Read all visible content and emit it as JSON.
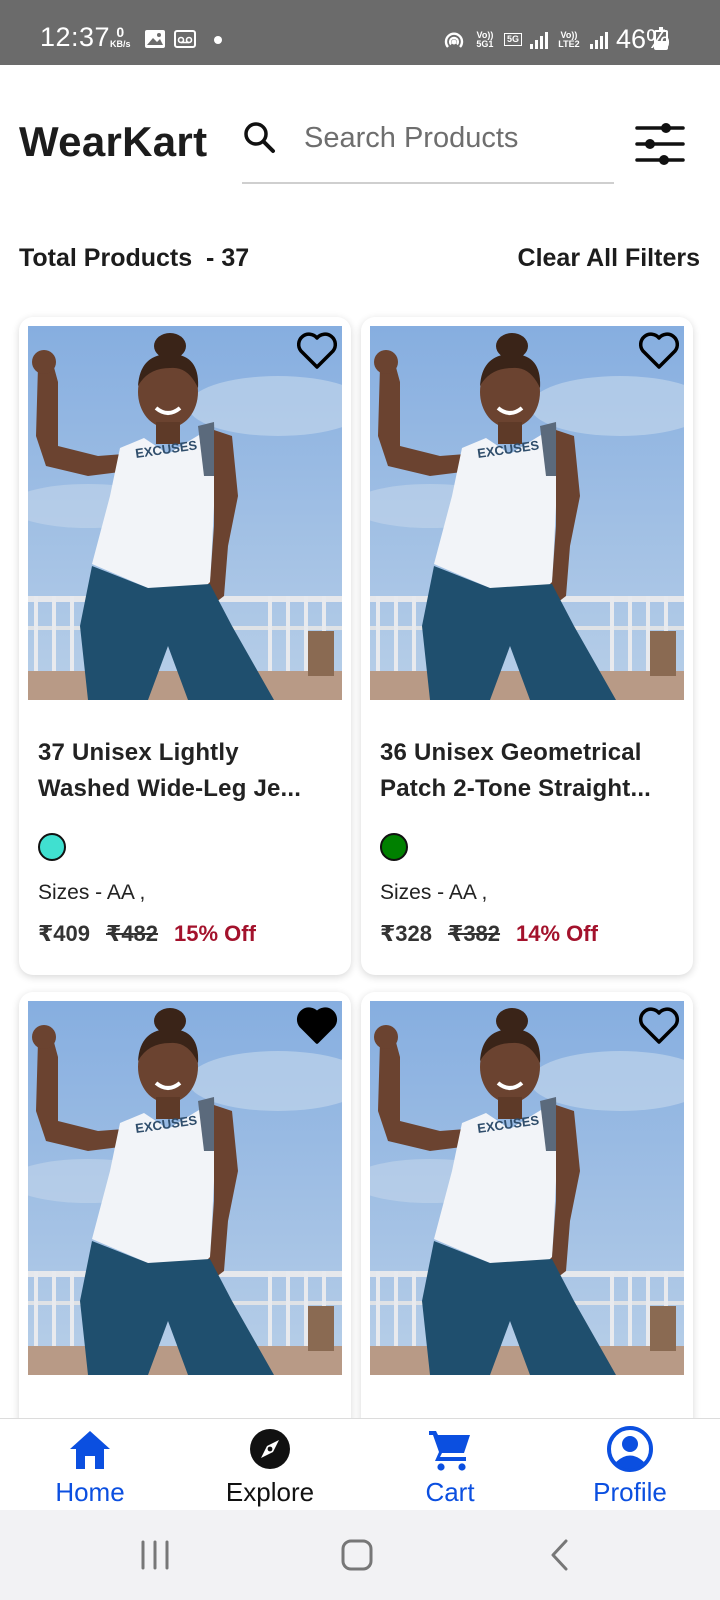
{
  "status_bar": {
    "time": "12:37",
    "net_speed_value": "0",
    "net_speed_unit": "KB/s",
    "volte1": "Vo)) 5G1",
    "fiveg": "5G",
    "volte2": "Vo)) LTE2",
    "battery": "46%"
  },
  "header": {
    "brand": "WearKart",
    "search_placeholder": "Search Products",
    "search_value": ""
  },
  "summary": {
    "total_label": "Total Products  - 37",
    "clear_filters": "Clear All Filters"
  },
  "products": [
    {
      "title_line1": "37 Unisex Lightly",
      "title_line2": "Washed Wide-Leg Je...",
      "color": "#40e0d0",
      "sizes": "Sizes - AA ,",
      "price": "₹409",
      "mrp": "₹482",
      "discount": "15% Off",
      "favorite": false
    },
    {
      "title_line1": "36 Unisex Geometrical",
      "title_line2": "Patch 2-Tone Straight...",
      "color": "#008000",
      "sizes": "Sizes - AA ,",
      "price": "₹328",
      "mrp": "₹382",
      "discount": "14% Off",
      "favorite": false
    },
    {
      "favorite": true
    },
    {
      "favorite": false
    }
  ],
  "bottom_nav": {
    "items": [
      {
        "label": "Home",
        "icon": "home-icon",
        "color": "#0b4fe0"
      },
      {
        "label": "Explore",
        "icon": "compass-icon",
        "color": "#111111"
      },
      {
        "label": "Cart",
        "icon": "cart-icon",
        "color": "#0b4fe0"
      },
      {
        "label": "Profile",
        "icon": "profile-icon",
        "color": "#0b4fe0"
      }
    ]
  },
  "colors": {
    "accent": "#0b4fe0",
    "discount": "#a3122c",
    "status_bar": "#6b6b6b"
  }
}
